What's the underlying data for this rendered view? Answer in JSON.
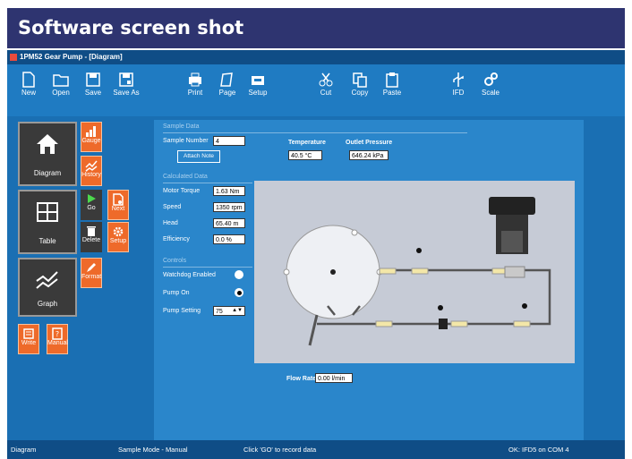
{
  "banner": {
    "title": "Software screen shot"
  },
  "window": {
    "title": "1PM52 Gear Pump - [Diagram]"
  },
  "toolbar": {
    "new": "New",
    "open": "Open",
    "save": "Save",
    "save_as": "Save As",
    "print": "Print",
    "page": "Page",
    "setup": "Setup",
    "cut": "Cut",
    "copy": "Copy",
    "paste": "Paste",
    "ifd": "IFD",
    "scale": "Scale"
  },
  "left_panel": {
    "diagram": "Diagram",
    "table": "Table",
    "graph": "Graph",
    "gauge": "Gauge",
    "history": "History",
    "go": "Go",
    "next": "Next",
    "delete": "Delete",
    "setup": "Setup",
    "format": "Format",
    "write": "Write",
    "manual": "Manual"
  },
  "sample": {
    "header": "Sample Data",
    "number_label": "Sample Number",
    "number_value": "4",
    "attach_button": "Attach Note",
    "temperature_label": "Temperature",
    "temperature_value": "40.5 °C",
    "outlet_label": "Outlet Pressure",
    "outlet_value": "646.24 kPa"
  },
  "calculated": {
    "header": "Calculated Data",
    "motor_torque_label": "Motor Torque",
    "motor_torque_value": "1.63 Nm",
    "speed_label": "Speed",
    "speed_value": "1350 rpm",
    "head_label": "Head",
    "head_value": "65.40 m",
    "efficiency_label": "Efficiency",
    "efficiency_value": "0.0 %"
  },
  "controls": {
    "header": "Controls",
    "watchdog_label": "Watchdog Enabled",
    "pump_on_label": "Pump On",
    "pump_setting_label": "Pump Setting",
    "pump_setting_value": "75"
  },
  "flow": {
    "label": "Flow Rate",
    "value": "0.00 l/min"
  },
  "status": {
    "view": "Diagram",
    "mode": "Sample Mode - Manual",
    "hint": "Click 'GO' to record data",
    "connection": "OK: IFD5 on COM 4"
  },
  "colors": {
    "banner": "#2e3470",
    "window": "#1a6fb3",
    "orange": "#ee6a2a"
  }
}
